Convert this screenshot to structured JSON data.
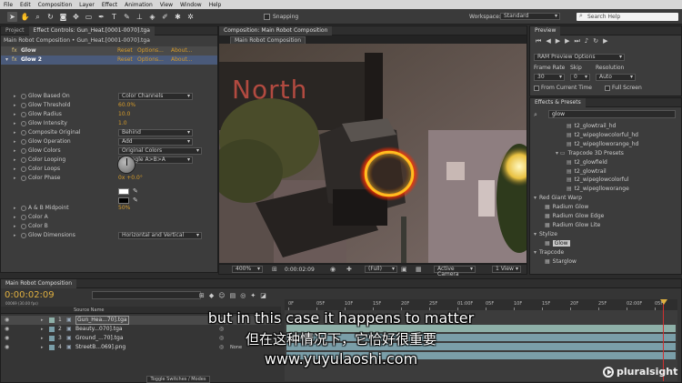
{
  "menu": [
    "File",
    "Edit",
    "Composition",
    "Layer",
    "Effect",
    "Animation",
    "View",
    "Window",
    "Help"
  ],
  "toolbar": {
    "snapping_label": "Snapping",
    "workspace_label": "Workspace:",
    "workspace_value": "Standard",
    "search_placeholder": "Search Help"
  },
  "effect_controls": {
    "tabs": [
      "Project",
      "Effect Controls: Gun_Heat.[0001-0070].tga"
    ],
    "breadcrumb": "Main Robot Composition • Gun_Heat.[0001-0070].tga",
    "effects": [
      {
        "name": "Glow",
        "reset": "Reset",
        "options": "Options...",
        "about": "About..."
      },
      {
        "name": "Glow 2",
        "reset": "Reset",
        "options": "Options...",
        "about": "About..."
      }
    ],
    "rows": [
      {
        "label": "Glow Based On",
        "dropdown": "Color Channels"
      },
      {
        "label": "Glow Threshold",
        "value": "60.0%"
      },
      {
        "label": "Glow Radius",
        "value": "10.0"
      },
      {
        "label": "Glow Intensity",
        "value": "1.0"
      },
      {
        "label": "Composite Original",
        "dropdown": "Behind"
      },
      {
        "label": "Glow Operation",
        "dropdown": "Add"
      },
      {
        "label": "Glow Colors",
        "dropdown": "Original Colors"
      },
      {
        "label": "Color Looping",
        "dropdown": "Triangle A>B>A"
      },
      {
        "label": "Color Loops",
        "value": "1.0"
      },
      {
        "label": "Color Phase",
        "value": "0x +0.0°"
      },
      {
        "label": "A & B Midpoint",
        "value": "50%"
      },
      {
        "label": "Color A",
        "value": ""
      },
      {
        "label": "Color B",
        "value": ""
      },
      {
        "label": "Glow Dimensions",
        "dropdown": "Horizontal and Vertical"
      }
    ]
  },
  "composition": {
    "tab": "Composition: Main Robot Composition",
    "subtab": "Main Robot Composition",
    "sign_text": "North",
    "zoom": "400%",
    "timecode": "0:00:02:09",
    "resolution": "(Full)",
    "camera": "Active Camera",
    "view": "1 View"
  },
  "preview": {
    "tab": "Preview",
    "ram_options": "RAM Preview Options",
    "frame_rate_label": "Frame Rate",
    "skip_label": "Skip",
    "resolution_label": "Resolution",
    "frame_rate_value": "30",
    "skip_value": "0",
    "resolution_value": "Auto",
    "from_current_time": "From Current Time",
    "full_screen": "Full Screen"
  },
  "effects_presets": {
    "tab": "Effects & Presets",
    "search_value": "glow",
    "items": [
      {
        "indent": 3,
        "label": "t2_glowtrail_hd",
        "type": "preset"
      },
      {
        "indent": 3,
        "label": "t2_wipeglowcolorful_hd",
        "type": "preset"
      },
      {
        "indent": 3,
        "label": "t2_wipeglloworange_hd",
        "type": "preset"
      },
      {
        "indent": 2,
        "label": "Trapcode 3D Presets",
        "type": "folder"
      },
      {
        "indent": 3,
        "label": "t2_glowfield",
        "type": "preset"
      },
      {
        "indent": 3,
        "label": "t2_glowtrail",
        "type": "preset"
      },
      {
        "indent": 3,
        "label": "t2_wipeglowcolorful",
        "type": "preset"
      },
      {
        "indent": 3,
        "label": "t2_wipeglloworange",
        "type": "preset"
      },
      {
        "indent": 0,
        "label": "Red Giant Warp",
        "type": "category"
      },
      {
        "indent": 1,
        "label": "Radium Glow",
        "type": "effect"
      },
      {
        "indent": 1,
        "label": "Radium Glow Edge",
        "type": "effect"
      },
      {
        "indent": 1,
        "label": "Radium Glow Lite",
        "type": "effect"
      },
      {
        "indent": 0,
        "label": "Stylize",
        "type": "category"
      },
      {
        "indent": 1,
        "label": "Glow",
        "type": "effect-selected"
      },
      {
        "indent": 0,
        "label": "Trapcode",
        "type": "category"
      },
      {
        "indent": 1,
        "label": "Starglow",
        "type": "effect"
      }
    ]
  },
  "timeline": {
    "tab": "Main Robot Composition",
    "timecode": "0:00:02:09",
    "timecode_sub": "00069 (30.00 fps)",
    "source_name_header": "Source Name",
    "layers": [
      {
        "num": "1",
        "name": "Gun_Hea...70].tga"
      },
      {
        "num": "2",
        "name": "Beauty...070].tga"
      },
      {
        "num": "3",
        "name": "Ground_...70].tga"
      },
      {
        "num": "4",
        "name": "StreetB...069].png"
      }
    ],
    "parent_value": "None",
    "ruler": [
      "0F",
      "05F",
      "10F",
      "15F",
      "20F",
      "25F",
      "01:00F",
      "05F",
      "10F",
      "15F",
      "20F",
      "25F",
      "02:00F",
      "05F"
    ],
    "toggle_label": "Toggle Switches / Modes"
  },
  "subtitles": {
    "english": "but in this case it happens to matter",
    "chinese": "但在这种情况下，它恰好很重要",
    "url": "www.yuyulaoshi.com"
  },
  "watermark": "pluralsight",
  "colors": {
    "accent_orange": "#d59b2a",
    "selection_blue": "#4a6a9a"
  }
}
